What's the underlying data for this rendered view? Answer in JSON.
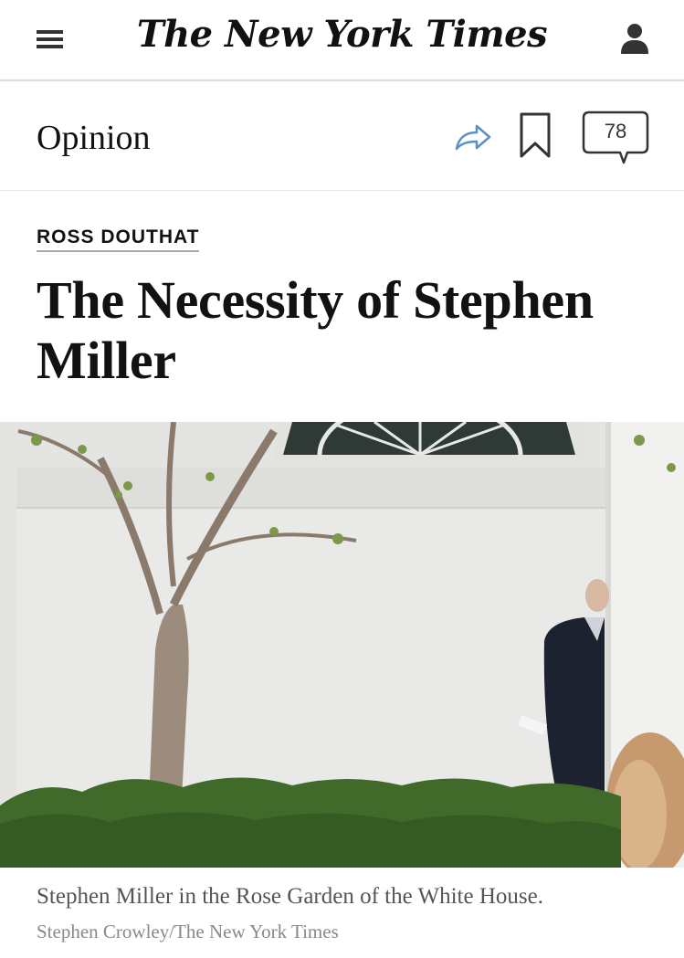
{
  "header": {
    "masthead": "The New York Times",
    "menu_icon": "hamburger-menu-icon",
    "account_icon": "user-icon"
  },
  "section_bar": {
    "section": "Opinion",
    "share_icon": "share-arrow-icon",
    "bookmark_icon": "bookmark-icon",
    "comments_count": "78"
  },
  "article": {
    "byline": "ROSS DOUTHAT",
    "headline": "The Necessity of Stephen Miller",
    "image_caption": "Stephen Miller in the Rose Garden of the White House.",
    "image_credit": "Stephen Crowley/The New York Times"
  },
  "colors": {
    "text": "#121212",
    "share_accent": "#5b8fc7",
    "divider": "#dcdcdc"
  }
}
